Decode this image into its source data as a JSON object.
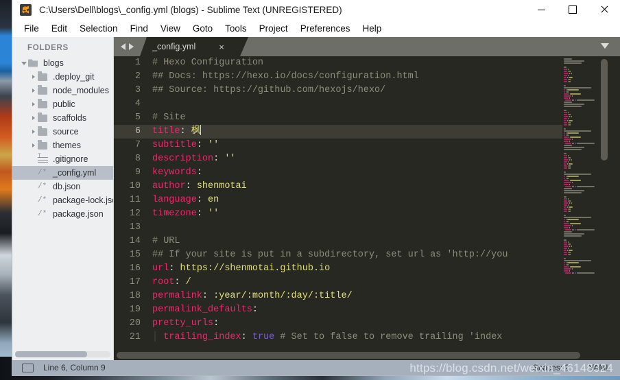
{
  "window": {
    "title": "C:\\Users\\Dell\\blogs\\_config.yml (blogs) - Sublime Text (UNREGISTERED)",
    "app_icon": "sublime-text-icon",
    "controls": {
      "minimize": "—",
      "maximize": "□",
      "close": "✕"
    }
  },
  "menubar": {
    "items": [
      {
        "label": "File"
      },
      {
        "label": "Edit"
      },
      {
        "label": "Selection"
      },
      {
        "label": "Find"
      },
      {
        "label": "View"
      },
      {
        "label": "Goto"
      },
      {
        "label": "Tools"
      },
      {
        "label": "Project"
      },
      {
        "label": "Preferences"
      },
      {
        "label": "Help"
      }
    ]
  },
  "sidebar": {
    "header": "FOLDERS",
    "items": [
      {
        "label": "blogs",
        "type": "folder-open",
        "depth": 0,
        "expanded": true,
        "selected": false
      },
      {
        "label": ".deploy_git",
        "type": "folder",
        "depth": 1,
        "expanded": false,
        "selected": false
      },
      {
        "label": "node_modules",
        "type": "folder",
        "depth": 1,
        "expanded": false,
        "selected": false
      },
      {
        "label": "public",
        "type": "folder",
        "depth": 1,
        "expanded": false,
        "selected": false
      },
      {
        "label": "scaffolds",
        "type": "folder",
        "depth": 1,
        "expanded": false,
        "selected": false
      },
      {
        "label": "source",
        "type": "folder",
        "depth": 1,
        "expanded": false,
        "selected": false
      },
      {
        "label": "themes",
        "type": "folder",
        "depth": 1,
        "expanded": false,
        "selected": false
      },
      {
        "label": ".gitignore",
        "type": "gitignore",
        "depth": 1,
        "expanded": null,
        "selected": false
      },
      {
        "label": "_config.yml",
        "type": "file",
        "depth": 1,
        "expanded": null,
        "selected": true
      },
      {
        "label": "db.json",
        "type": "file",
        "depth": 1,
        "expanded": null,
        "selected": false
      },
      {
        "label": "package-lock.json",
        "type": "file",
        "depth": 1,
        "expanded": null,
        "selected": false
      },
      {
        "label": "package.json",
        "type": "file",
        "depth": 1,
        "expanded": null,
        "selected": false
      }
    ]
  },
  "tabbar": {
    "nav_prev": "prev-arrow-icon",
    "nav_next": "next-arrow-icon",
    "tabs": [
      {
        "label": "_config.yml",
        "close": "×",
        "active": true
      }
    ],
    "overflow_menu": "chevron-down-icon"
  },
  "editor": {
    "active_line": 6,
    "cursor_after": "枫",
    "lines": [
      {
        "n": 1,
        "tokens": [
          {
            "t": "# Hexo Configuration",
            "c": "c-comment"
          }
        ]
      },
      {
        "n": 2,
        "tokens": [
          {
            "t": "## Docs: https://hexo.io/docs/configuration.html",
            "c": "c-comment"
          }
        ]
      },
      {
        "n": 3,
        "tokens": [
          {
            "t": "## Source: https://github.com/hexojs/hexo/",
            "c": "c-comment"
          }
        ]
      },
      {
        "n": 4,
        "tokens": []
      },
      {
        "n": 5,
        "tokens": [
          {
            "t": "# Site",
            "c": "c-comment"
          }
        ]
      },
      {
        "n": 6,
        "tokens": [
          {
            "t": "title",
            "c": "c-key"
          },
          {
            "t": ":",
            "c": "c-punc"
          },
          {
            "t": " 枫",
            "c": "c-val"
          }
        ]
      },
      {
        "n": 7,
        "tokens": [
          {
            "t": "subtitle",
            "c": "c-key"
          },
          {
            "t": ":",
            "c": "c-punc"
          },
          {
            "t": " ''",
            "c": "c-str"
          }
        ]
      },
      {
        "n": 8,
        "tokens": [
          {
            "t": "description",
            "c": "c-key"
          },
          {
            "t": ":",
            "c": "c-punc"
          },
          {
            "t": " ''",
            "c": "c-str"
          }
        ]
      },
      {
        "n": 9,
        "tokens": [
          {
            "t": "keywords",
            "c": "c-key"
          },
          {
            "t": ":",
            "c": "c-punc"
          }
        ]
      },
      {
        "n": 10,
        "tokens": [
          {
            "t": "author",
            "c": "c-key"
          },
          {
            "t": ":",
            "c": "c-punc"
          },
          {
            "t": " shenmotai",
            "c": "c-val"
          }
        ]
      },
      {
        "n": 11,
        "tokens": [
          {
            "t": "language",
            "c": "c-key"
          },
          {
            "t": ":",
            "c": "c-punc"
          },
          {
            "t": " en",
            "c": "c-val"
          }
        ]
      },
      {
        "n": 12,
        "tokens": [
          {
            "t": "timezone",
            "c": "c-key"
          },
          {
            "t": ":",
            "c": "c-punc"
          },
          {
            "t": " ''",
            "c": "c-str"
          }
        ]
      },
      {
        "n": 13,
        "tokens": []
      },
      {
        "n": 14,
        "tokens": [
          {
            "t": "# URL",
            "c": "c-comment"
          }
        ]
      },
      {
        "n": 15,
        "tokens": [
          {
            "t": "## If your site is put in a subdirectory, set url as 'http://you",
            "c": "c-comment"
          }
        ]
      },
      {
        "n": 16,
        "tokens": [
          {
            "t": "url",
            "c": "c-key"
          },
          {
            "t": ":",
            "c": "c-punc"
          },
          {
            "t": " https://shenmotai.github.io",
            "c": "c-val"
          }
        ]
      },
      {
        "n": 17,
        "tokens": [
          {
            "t": "root",
            "c": "c-key"
          },
          {
            "t": ":",
            "c": "c-punc"
          },
          {
            "t": " /",
            "c": "c-val"
          }
        ]
      },
      {
        "n": 18,
        "tokens": [
          {
            "t": "permalink",
            "c": "c-key"
          },
          {
            "t": ":",
            "c": "c-punc"
          },
          {
            "t": " :year/:month/:day/:title/",
            "c": "c-val"
          }
        ]
      },
      {
        "n": 19,
        "tokens": [
          {
            "t": "permalink_defaults",
            "c": "c-key"
          },
          {
            "t": ":",
            "c": "c-punc"
          }
        ]
      },
      {
        "n": 20,
        "tokens": [
          {
            "t": "pretty_urls",
            "c": "c-key"
          },
          {
            "t": ":",
            "c": "c-punc"
          }
        ]
      },
      {
        "n": 21,
        "tokens": [
          {
            "t": "│ ",
            "c": "c-indent"
          },
          {
            "t": "trailing_index",
            "c": "c-key"
          },
          {
            "t": ":",
            "c": "c-punc"
          },
          {
            "t": " ",
            "c": "c-punc"
          },
          {
            "t": "true",
            "c": "c-bool"
          },
          {
            "t": " # Set to false to remove trailing 'index",
            "c": "c-comment"
          }
        ]
      }
    ]
  },
  "statusbar": {
    "icon": "panel-icon",
    "position": "Line 6, Column 9",
    "indentation": "Spaces: 2",
    "syntax": "YAML"
  },
  "watermark": {
    "text": "https://blog.csdn.net/weixin_46148324"
  },
  "colors": {
    "editor_bg": "#272822",
    "active_line": "#3d3d35",
    "key": "#f0266f",
    "string": "#e2e07a",
    "comment": "#8d8d7f",
    "boolean": "#7a5cd8",
    "statusbar": "#a6b0bd",
    "tabbar": "#6e6e68",
    "sidebar": "#edeff0",
    "sidebar_selected": "#b9bfc9"
  }
}
